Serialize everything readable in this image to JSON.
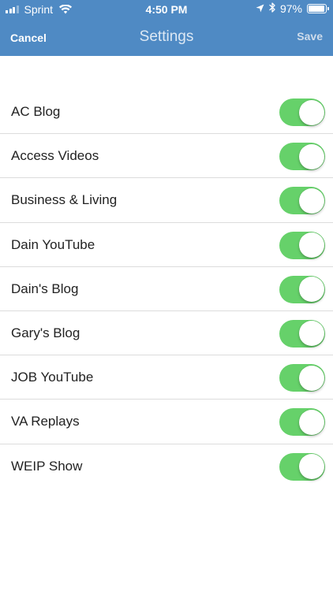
{
  "status_bar": {
    "carrier": "Sprint",
    "time": "4:50 PM",
    "battery": "97%",
    "battery_level": 0.97
  },
  "nav": {
    "cancel_label": "Cancel",
    "title": "Settings",
    "save_label": "Save"
  },
  "colors": {
    "header": "#4f8ac4",
    "toggle_on": "#66d16a"
  },
  "items": [
    {
      "label": "AC Blog",
      "on": true
    },
    {
      "label": "Access Videos",
      "on": true
    },
    {
      "label": "Business & Living",
      "on": true
    },
    {
      "label": "Dain YouTube",
      "on": true
    },
    {
      "label": "Dain's Blog",
      "on": true
    },
    {
      "label": "Gary's Blog",
      "on": true
    },
    {
      "label": "JOB YouTube",
      "on": true
    },
    {
      "label": "VA Replays",
      "on": true
    },
    {
      "label": "WEIP Show",
      "on": true
    }
  ]
}
